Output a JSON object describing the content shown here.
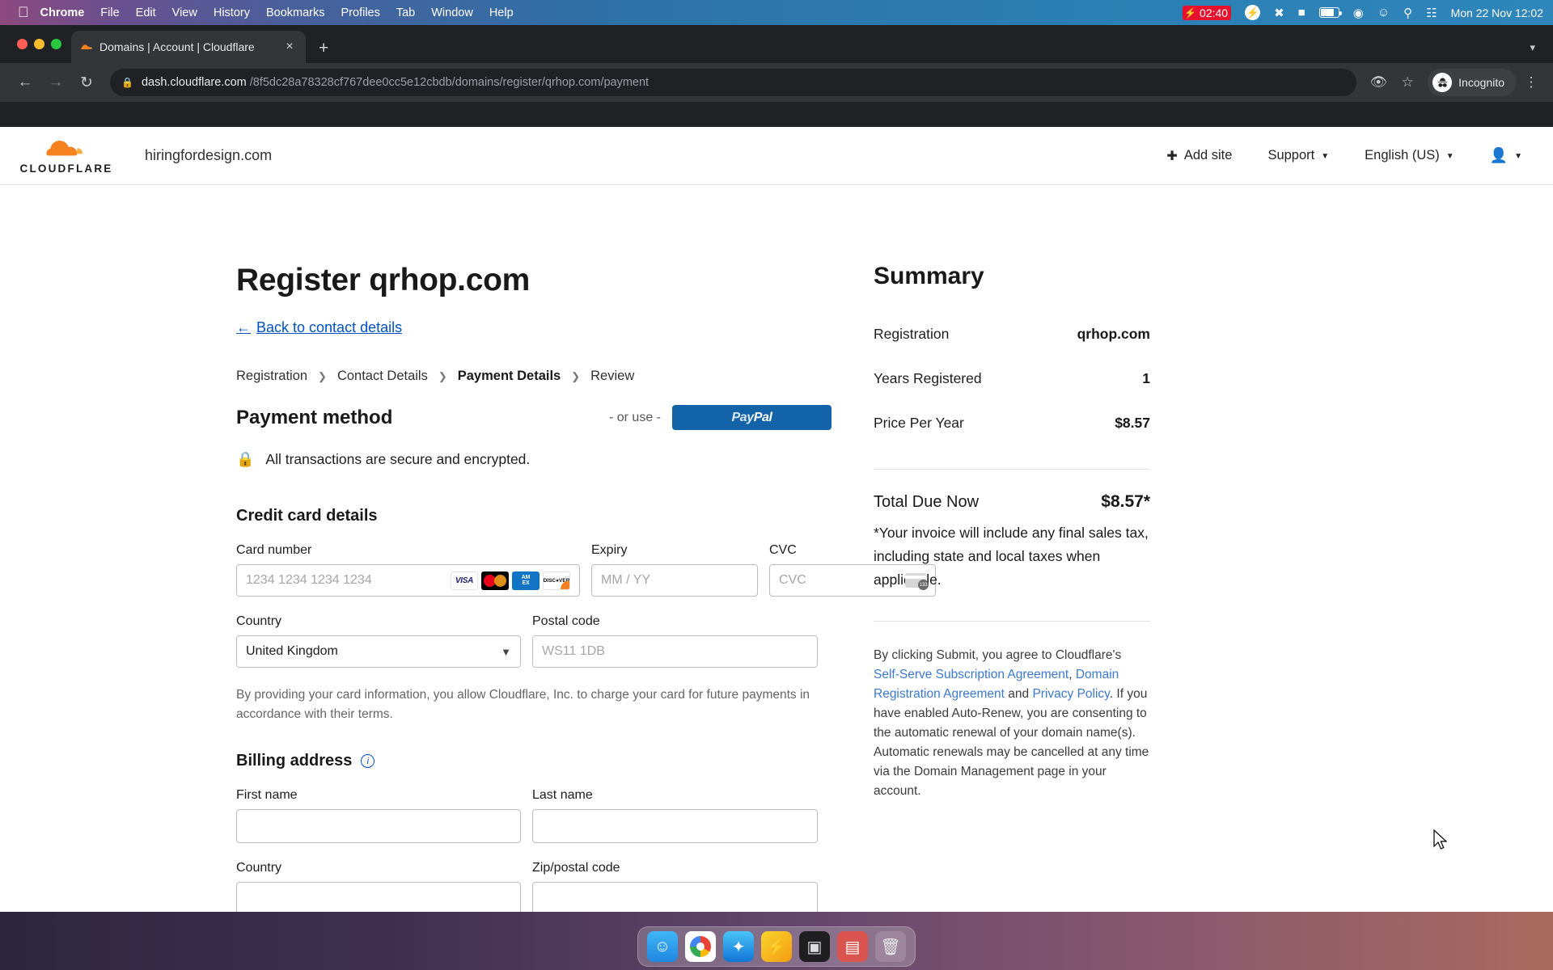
{
  "menubar": {
    "apple_icon": "apple-icon",
    "items": [
      "Chrome",
      "File",
      "Edit",
      "View",
      "History",
      "Bookmarks",
      "Profiles",
      "Tab",
      "Window",
      "Help"
    ],
    "battery_time": "02:40",
    "date_time": "Mon 22 Nov  12:02",
    "icons": [
      "bolt-circle-icon",
      "bluetooth-off-icon",
      "keyboard-brightness-icon",
      "battery-icon",
      "wifi-icon",
      "account-icon",
      "search-icon",
      "control-center-icon"
    ]
  },
  "browser": {
    "tab_title": "Domains | Account | Cloudflare",
    "tab_favicon": "cloudflare-favicon",
    "new_tab_label": "+",
    "close_label": "×",
    "tabstrip_chevron": "▾",
    "nav": {
      "back": "←",
      "forward": "→",
      "reload": "↻"
    },
    "url_lock": "lock-icon",
    "url_host": "dash.cloudflare.com",
    "url_path": "/8f5dc28a78328cf767dee0cc5e12cbdb/domains/register/qrhop.com/payment",
    "omni_icons": [
      "eye-off-icon",
      "bookmark-star-icon"
    ],
    "profile_label": "Incognito",
    "menu_icon": "⋮"
  },
  "cf_header": {
    "logo_word": "CLOUDFLARE",
    "site_name": "hiringfordesign.com",
    "add_site": "Add site",
    "support": "Support",
    "language": "English (US)"
  },
  "main": {
    "title": "Register qrhop.com",
    "back_link": "Back to contact details",
    "breadcrumbs": [
      {
        "label": "Registration",
        "current": false
      },
      {
        "label": "Contact Details",
        "current": false
      },
      {
        "label": "Payment Details",
        "current": true
      },
      {
        "label": "Review",
        "current": false
      }
    ],
    "payment_method_heading": "Payment method",
    "or_use": "- or use -",
    "paypal_pay": "Pay",
    "paypal_pal": "Pal",
    "secure_note": "All transactions are secure and encrypted.",
    "credit_card_heading": "Credit card details",
    "card_number_label": "Card number",
    "card_number_placeholder": "1234 1234 1234 1234",
    "expiry_label": "Expiry",
    "expiry_placeholder": "MM / YY",
    "cvc_label": "CVC",
    "cvc_placeholder": "CVC",
    "country_label": "Country",
    "country_value": "United Kingdom",
    "postal_label": "Postal code",
    "postal_placeholder": "WS11 1DB",
    "card_brands": [
      "VISA",
      "Mastercard",
      "AMEX",
      "DISCOVER"
    ],
    "amex_line1": "AM",
    "amex_line2": "EX",
    "discover_label": "DISC●VER",
    "visa_label": "VISA",
    "cvc_hint_number": "133",
    "disclaimer": "By providing your card information, you allow Cloudflare, Inc. to charge your card for future payments in accordance with their terms.",
    "billing_heading": "Billing address",
    "billing_info_icon": "info-icon",
    "first_name_label": "First name",
    "last_name_label": "Last name",
    "billing_country_label": "Country",
    "zip_label": "Zip/postal code"
  },
  "summary": {
    "title": "Summary",
    "rows": [
      {
        "key": "Registration",
        "value": "qrhop.com"
      },
      {
        "key": "Years Registered",
        "value": "1"
      },
      {
        "key": "Price Per Year",
        "value": "$8.57"
      }
    ],
    "total_label": "Total Due Now",
    "total_value": "$8.57*",
    "total_note": "*Your invoice will include any final sales tax, including state and local taxes when applicable.",
    "legal_pre": "By clicking Submit, you agree to Cloudflare's ",
    "legal_link1": "Self-Serve Subscription Agreement",
    "legal_mid1": ", ",
    "legal_link2": "Domain Registration Agreement",
    "legal_mid2": " and ",
    "legal_link3": "Privacy Policy",
    "legal_post": ". If you have enabled Auto-Renew, you are consenting to the automatic renewal of your domain name(s). Automatic renewals may be cancelled at any time via the Domain Management page in your account."
  },
  "dock": {
    "items": [
      "finder-icon",
      "chrome-icon",
      "safari-icon",
      "shortcuts-icon",
      "camera-icon",
      "wallet-icon",
      "trash-icon"
    ]
  },
  "colors": {
    "cf_orange": "#f6821f",
    "link_blue": "#0051c3",
    "paypal_blue": "#1263a8"
  }
}
